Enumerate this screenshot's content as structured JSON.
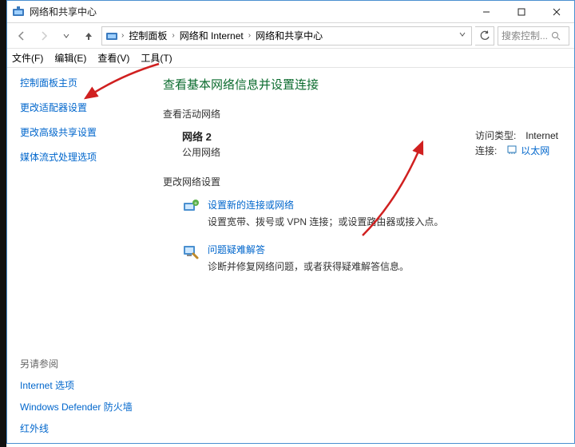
{
  "window": {
    "title": "网络和共享中心"
  },
  "nav": {
    "breadcrumbs": [
      "控制面板",
      "网络和 Internet",
      "网络和共享中心"
    ],
    "search_placeholder": "搜索控制..."
  },
  "menu": {
    "file": "文件(F)",
    "edit": "编辑(E)",
    "view": "查看(V)",
    "tools": "工具(T)"
  },
  "sidebar": {
    "home": "控制面板主页",
    "adapter_settings": "更改适配器设置",
    "advanced_sharing": "更改高级共享设置",
    "media_streaming": "媒体流式处理选项",
    "see_also_title": "另请参阅",
    "see_also": {
      "internet_options": "Internet 选项",
      "defender_firewall": "Windows Defender 防火墙",
      "infrared": "红外线"
    }
  },
  "content": {
    "page_title": "查看基本网络信息并设置连接",
    "active_networks_head": "查看活动网络",
    "network": {
      "name": "网络 2",
      "type": "公用网络",
      "access_label": "访问类型:",
      "access_value": "Internet",
      "conn_label": "连接:",
      "conn_value": "以太网"
    },
    "change_head": "更改网络设置",
    "items": {
      "new_conn": {
        "title": "设置新的连接或网络",
        "desc": "设置宽带、拨号或 VPN 连接；或设置路由器或接入点。"
      },
      "troubleshoot": {
        "title": "问题疑难解答",
        "desc": "诊断并修复网络问题，或者获得疑难解答信息。"
      }
    }
  }
}
